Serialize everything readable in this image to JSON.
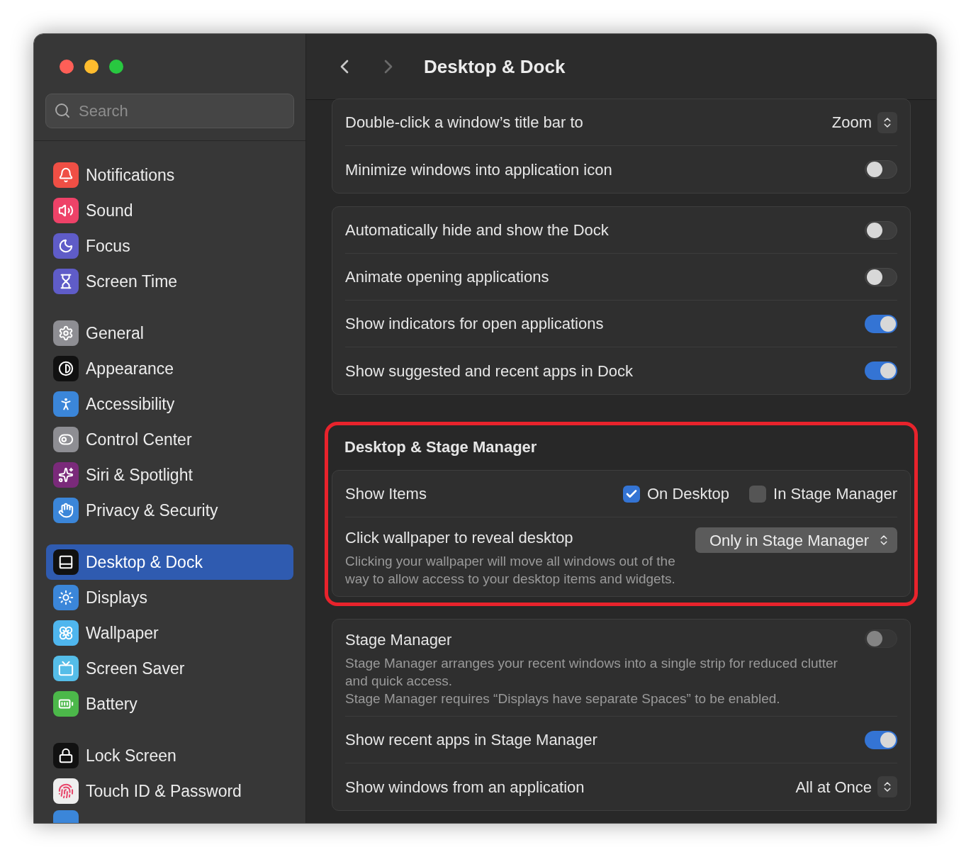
{
  "window": {
    "title": "Desktop & Dock"
  },
  "search": {
    "placeholder": "Search"
  },
  "sidebar": {
    "groups": [
      [
        {
          "label": "Notifications",
          "selected": false
        },
        {
          "label": "Sound",
          "selected": false
        },
        {
          "label": "Focus",
          "selected": false
        },
        {
          "label": "Screen Time",
          "selected": false
        }
      ],
      [
        {
          "label": "General",
          "selected": false
        },
        {
          "label": "Appearance",
          "selected": false
        },
        {
          "label": "Accessibility",
          "selected": false
        },
        {
          "label": "Control Center",
          "selected": false
        },
        {
          "label": "Siri & Spotlight",
          "selected": false
        },
        {
          "label": "Privacy & Security",
          "selected": false
        }
      ],
      [
        {
          "label": "Desktop & Dock",
          "selected": true
        },
        {
          "label": "Displays",
          "selected": false
        },
        {
          "label": "Wallpaper",
          "selected": false
        },
        {
          "label": "Screen Saver",
          "selected": false
        },
        {
          "label": "Battery",
          "selected": false
        }
      ],
      [
        {
          "label": "Lock Screen",
          "selected": false
        },
        {
          "label": "Touch ID & Password",
          "selected": false
        }
      ]
    ]
  },
  "sections": [
    {
      "highlighted": false,
      "rows": [
        {
          "kind": "select",
          "label": "Double-click a window’s title bar to",
          "value": "Zoom"
        },
        {
          "kind": "toggle",
          "label": "Minimize windows into application icon",
          "on": false,
          "disabled": false
        }
      ]
    },
    {
      "highlighted": false,
      "rows": [
        {
          "kind": "toggle",
          "label": "Automatically hide and show the Dock",
          "on": false,
          "disabled": false
        },
        {
          "kind": "toggle",
          "label": "Animate opening applications",
          "on": false,
          "disabled": false
        },
        {
          "kind": "toggle",
          "label": "Show indicators for open applications",
          "on": true,
          "disabled": false
        },
        {
          "kind": "toggle",
          "label": "Show suggested and recent apps in Dock",
          "on": true,
          "disabled": false
        }
      ]
    },
    {
      "title": "Desktop & Stage Manager",
      "highlighted": true,
      "rows": [
        {
          "kind": "checkboxes",
          "label": "Show Items",
          "options": [
            {
              "label": "On Desktop",
              "checked": true
            },
            {
              "label": "In Stage Manager",
              "checked": false
            }
          ]
        },
        {
          "kind": "popup",
          "label": "Click wallpaper to reveal desktop",
          "description": [
            "Clicking your wallpaper will move all windows out of the way to allow access to your desktop items and widgets."
          ],
          "value": "Only in Stage Manager"
        }
      ]
    },
    {
      "highlighted": false,
      "rows": [
        {
          "kind": "toggle",
          "label": "Stage Manager",
          "description": [
            "Stage Manager arranges your recent windows into a single strip for reduced clutter and quick access.",
            "Stage Manager requires “Displays have separate Spaces” to be enabled."
          ],
          "on": false,
          "disabled": true
        },
        {
          "kind": "toggle",
          "label": "Show recent apps in Stage Manager",
          "on": true,
          "disabled": false
        },
        {
          "kind": "select",
          "label": "Show windows from an application",
          "value": "All at Once"
        }
      ]
    }
  ]
}
